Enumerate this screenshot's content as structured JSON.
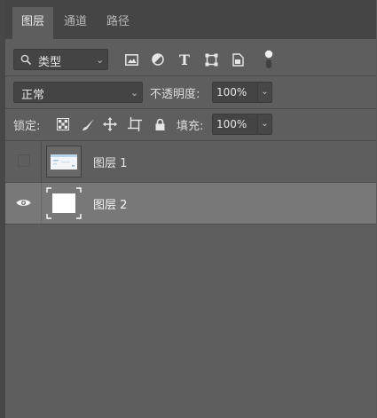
{
  "tabs": [
    {
      "label": "图层",
      "active": true
    },
    {
      "label": "通道",
      "active": false
    },
    {
      "label": "路径",
      "active": false
    }
  ],
  "filter": {
    "kind_label": "类型",
    "icons": [
      "image-filter-icon",
      "adjustment-filter-icon",
      "type-filter-icon",
      "shape-filter-icon",
      "smart-object-filter-icon",
      "filter-toggle-icon"
    ],
    "type_glyph": "T"
  },
  "blend": {
    "mode": "正常",
    "opacity_label": "不透明度:",
    "opacity_value": "100%"
  },
  "lock": {
    "label": "锁定:",
    "icons": [
      "lock-transparent-pixels-icon",
      "lock-image-pixels-icon",
      "lock-position-icon",
      "lock-artboard-icon",
      "lock-all-icon"
    ],
    "fill_label": "填充:",
    "fill_value": "100%"
  },
  "layers": [
    {
      "name": "图层 1",
      "visible": false,
      "selected": false
    },
    {
      "name": "图层 2",
      "visible": true,
      "selected": true
    }
  ],
  "colors": {
    "panel_bg": "#5e5e5e",
    "tabbar_bg": "#454545",
    "selected_row": "#787878"
  }
}
